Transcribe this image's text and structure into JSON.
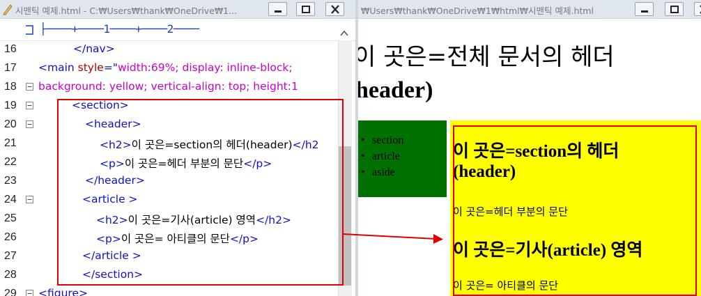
{
  "editor": {
    "title": "시맨틱 예제.html - C:₩Users₩thank₩OneDrive₩1...",
    "ruler": "├────+────1────+────2────",
    "lines": [
      {
        "num": "16",
        "indent": 105,
        "fold": false,
        "parts": [
          {
            "c": "tag",
            "t": "</nav>"
          }
        ]
      },
      {
        "num": "17",
        "indent": 55,
        "fold": false,
        "parts": [
          {
            "c": "tag",
            "t": "<main "
          },
          {
            "c": "attr",
            "t": "style"
          },
          {
            "c": "tag",
            "t": "=\""
          },
          {
            "c": "val",
            "t": "width:69%; display: inline-block;"
          }
        ]
      },
      {
        "num": "18",
        "indent": 55,
        "fold": true,
        "parts": [
          {
            "c": "val",
            "t": "background: yellow; vertical-align: top; height:1"
          }
        ]
      },
      {
        "num": "19",
        "indent": 103,
        "fold": true,
        "parts": [
          {
            "c": "tag",
            "t": "<section>"
          }
        ]
      },
      {
        "num": "20",
        "indent": 122,
        "fold": true,
        "parts": [
          {
            "c": "tag",
            "t": "<header>"
          }
        ]
      },
      {
        "num": "21",
        "indent": 143,
        "fold": false,
        "parts": [
          {
            "c": "tag",
            "t": "<h2>"
          },
          {
            "c": "txt",
            "t": "이 곳은=section의 헤더(header)"
          },
          {
            "c": "tag",
            "t": "</h2"
          }
        ]
      },
      {
        "num": "22",
        "indent": 143,
        "fold": false,
        "parts": [
          {
            "c": "tag",
            "t": "<p>"
          },
          {
            "c": "txt",
            "t": "이 곳은=헤더 부분의 문단"
          },
          {
            "c": "tag",
            "t": "</p>"
          }
        ]
      },
      {
        "num": "23",
        "indent": 122,
        "fold": false,
        "parts": [
          {
            "c": "tag",
            "t": "</header>"
          }
        ]
      },
      {
        "num": "24",
        "indent": 118,
        "fold": true,
        "parts": [
          {
            "c": "tag",
            "t": "<article >"
          }
        ]
      },
      {
        "num": "25",
        "indent": 138,
        "fold": false,
        "parts": [
          {
            "c": "tag",
            "t": "<h2>"
          },
          {
            "c": "txt",
            "t": "이 곳은=기사(article) 영역"
          },
          {
            "c": "tag",
            "t": "</h2>"
          }
        ]
      },
      {
        "num": "26",
        "indent": 138,
        "fold": false,
        "parts": [
          {
            "c": "tag",
            "t": "<p>"
          },
          {
            "c": "txt",
            "t": "이 곳은= 아티클의 문단"
          },
          {
            "c": "tag",
            "t": "</p>"
          }
        ]
      },
      {
        "num": "27",
        "indent": 118,
        "fold": false,
        "parts": [
          {
            "c": "tag",
            "t": "</article >"
          }
        ]
      },
      {
        "num": "28",
        "indent": 118,
        "fold": false,
        "parts": [
          {
            "c": "tag",
            "t": "</section>"
          }
        ]
      },
      {
        "num": "29",
        "indent": 55,
        "fold": true,
        "parts": [
          {
            "c": "tag",
            "t": "<figure>"
          }
        ]
      }
    ]
  },
  "browser": {
    "title": "₩Users₩thank₩OneDrive₩1₩html₩시맨틱 예제.html",
    "header_line1": "이 곳은=전체 문서의 헤더",
    "header_line2": "header)",
    "nav_items": [
      "section",
      "article",
      "aside"
    ],
    "section_header_h2_line1": "이 곳은=section의 헤더",
    "section_header_h2_line2": "(header)",
    "section_header_p": "이 곳은=헤더 부분의 문단",
    "article_h2": "이 곳은=기사(article) 영역",
    "article_p": "이 곳은= 아티클의 문단"
  },
  "colors": {
    "tag": "#1010c8",
    "attribute": "#b40000",
    "value": "#c800c8",
    "highlight_box": "#e00000",
    "nav_background": "#007000",
    "main_background": "#ffff00"
  }
}
